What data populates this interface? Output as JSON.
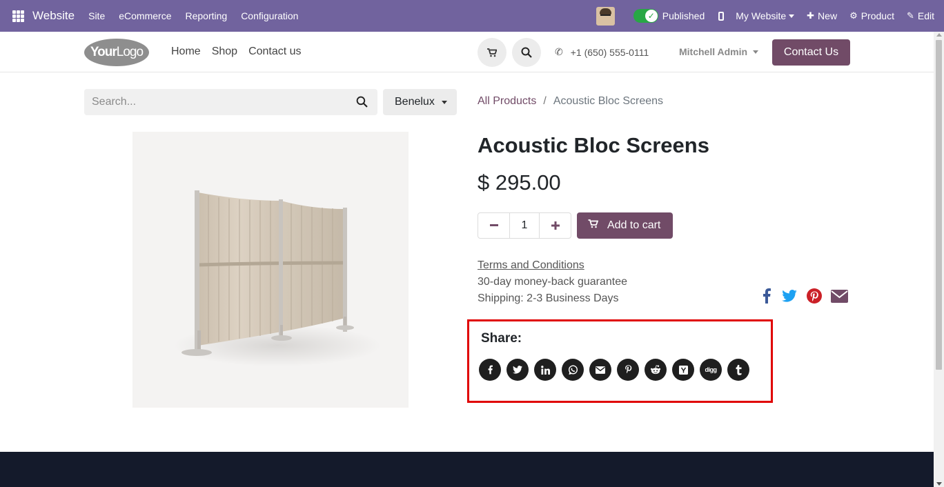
{
  "admin": {
    "brand": "Website",
    "menu": [
      "Site",
      "eCommerce",
      "Reporting",
      "Configuration"
    ],
    "published": "Published",
    "my_website": "My Website",
    "new": "New",
    "product": "Product",
    "edit": "Edit"
  },
  "header": {
    "logo_a": "Your",
    "logo_b": "Logo",
    "nav": [
      "Home",
      "Shop",
      "Contact us"
    ],
    "phone": "+1 (650) 555-0111",
    "user": "Mitchell Admin",
    "contact_btn": "Contact Us"
  },
  "search": {
    "placeholder": "Search..."
  },
  "pricelist": "Benelux",
  "breadcrumb": {
    "parent": "All Products",
    "sep": "/",
    "current": "Acoustic Bloc Screens"
  },
  "product": {
    "name": "Acoustic Bloc Screens",
    "price": "$ 295.00",
    "quantity": "1",
    "add_to_cart": "Add to cart",
    "terms": "Terms and Conditions",
    "guarantee": "30-day money-back guarantee",
    "shipping": "Shipping: 2-3 Business Days"
  },
  "share": {
    "label": "Share:",
    "networks": [
      "facebook",
      "twitter",
      "linkedin",
      "whatsapp",
      "email",
      "pinterest",
      "reddit",
      "hacker-news",
      "digg",
      "tumblr"
    ]
  },
  "colors": {
    "admin_bar": "#71639e",
    "brand": "#714b67",
    "highlight": "#e00000",
    "footer": "#141a2b"
  }
}
